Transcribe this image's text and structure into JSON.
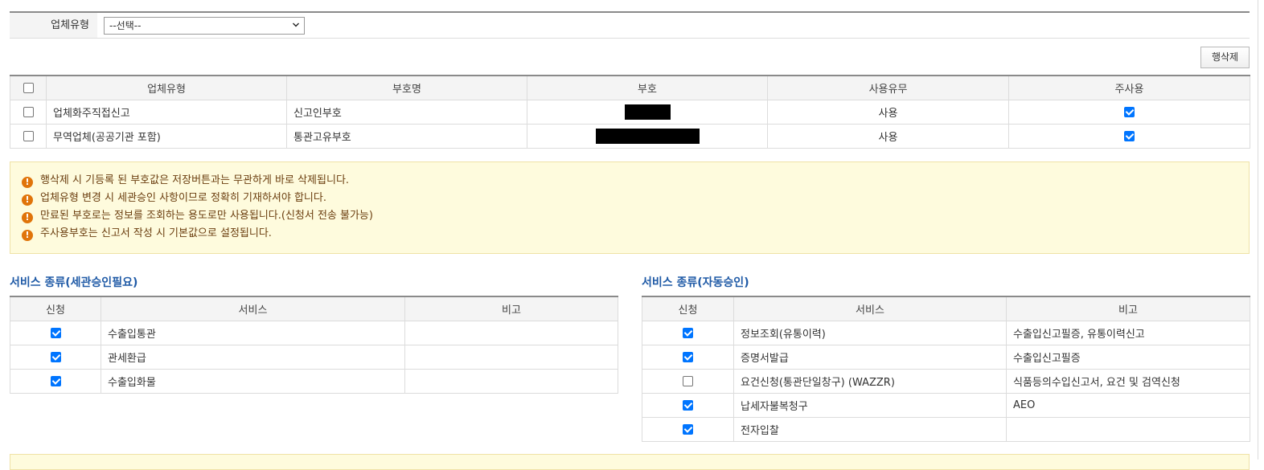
{
  "filter": {
    "label": "업체유형",
    "select_value": "--선택--"
  },
  "actions": {
    "delete_row_label": "행삭제"
  },
  "registration_table": {
    "columns": [
      "업체유형",
      "부호명",
      "부호",
      "사용유무",
      "주사용"
    ],
    "rows": [
      {
        "checked": false,
        "type": "업체화주직접신고",
        "code_name": "신고인부호",
        "code": "[redacted]",
        "use": "사용",
        "primary": true
      },
      {
        "checked": false,
        "type": "무역업체(공공기관 포함)",
        "code_name": "통관고유부호",
        "code": "[redacted]",
        "use": "사용",
        "primary": true
      }
    ]
  },
  "notices": [
    "행삭제 시 기등록 된 부호값은 저장버튼과는 무관하게 바로 삭제됩니다.",
    "업체유형 변경 시 세관승인 사항이므로 정확히 기재하셔야 합니다.",
    "만료된 부호로는 정보를 조회하는 용도로만 사용됩니다.(신청서 전송 불가능)",
    "주사용부호는 신고서 작성 시 기본값으로 설정됩니다."
  ],
  "services_customs": {
    "title": "서비스 종류(세관승인필요)",
    "columns": [
      "신청",
      "서비스",
      "비고"
    ],
    "rows": [
      {
        "checked": true,
        "service": "수출입통관",
        "note": ""
      },
      {
        "checked": true,
        "service": "관세환급",
        "note": ""
      },
      {
        "checked": true,
        "service": "수출입화물",
        "note": ""
      }
    ]
  },
  "services_auto": {
    "title": "서비스 종류(자동승인)",
    "columns": [
      "신청",
      "서비스",
      "비고"
    ],
    "rows": [
      {
        "checked": true,
        "service": "정보조회(유통이력)",
        "note": "수출입신고필증, 유통이력신고"
      },
      {
        "checked": true,
        "service": "증명서발급",
        "note": "수출입신고필증"
      },
      {
        "checked": false,
        "service": "요건신청(통관단일창구) (WAZZR)",
        "note": "식품등의수입신고서, 요건 및 검역신청"
      },
      {
        "checked": true,
        "service": "납세자불복청구",
        "note": "AEO"
      },
      {
        "checked": true,
        "service": "전자입찰",
        "note": ""
      }
    ]
  }
}
